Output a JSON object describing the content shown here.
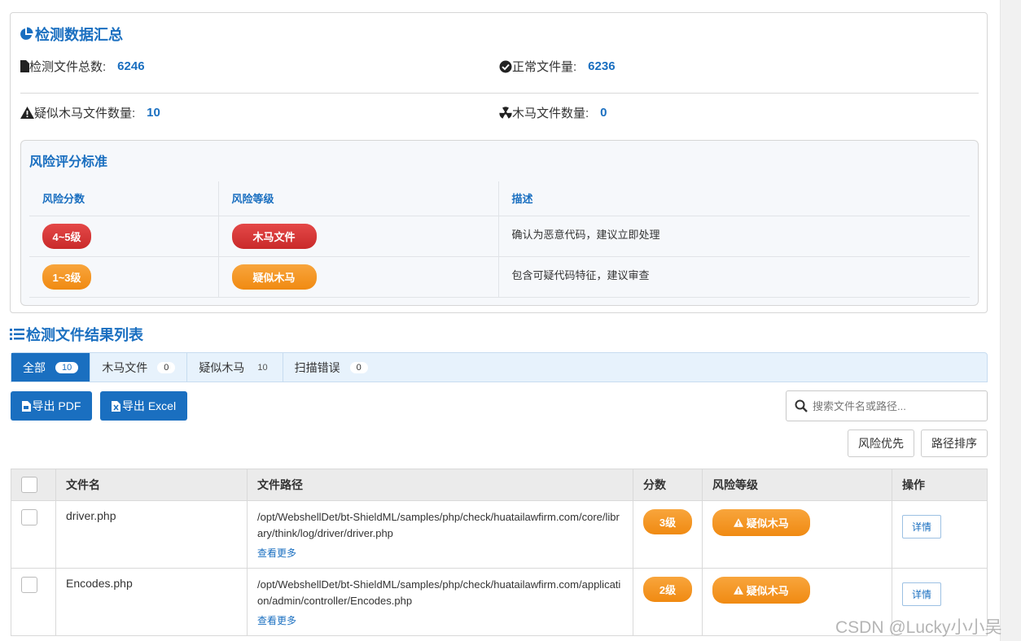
{
  "summary": {
    "title": "检测数据汇总",
    "total_label": "检测文件总数:",
    "total_value": "6246",
    "normal_label": "正常文件量:",
    "normal_value": "6236",
    "suspicious_label": "疑似木马文件数量:",
    "suspicious_value": "10",
    "trojan_label": "木马文件数量:",
    "trojan_value": "0"
  },
  "risk_standard": {
    "title": "风险评分标准",
    "headers": [
      "风险分数",
      "风险等级",
      "描述"
    ],
    "rows": [
      {
        "score": "4~5级",
        "level": "木马文件",
        "desc": "确认为恶意代码，建议立即处理"
      },
      {
        "score": "1~3级",
        "level": "疑似木马",
        "desc": "包含可疑代码特征，建议审查"
      }
    ]
  },
  "results": {
    "title": "检测文件结果列表",
    "tabs": [
      {
        "label": "全部",
        "count": "10"
      },
      {
        "label": "木马文件",
        "count": "0"
      },
      {
        "label": "疑似木马",
        "count": "10"
      },
      {
        "label": "扫描错误",
        "count": "0"
      }
    ],
    "export_pdf": "导出 PDF",
    "export_excel": "导出 Excel",
    "search_placeholder": "搜索文件名或路径...",
    "sort_risk": "风险优先",
    "sort_path": "路径排序",
    "columns": [
      "文件名",
      "文件路径",
      "分数",
      "风险等级",
      "操作"
    ],
    "rows": [
      {
        "name": "driver.php",
        "path": "/opt/WebshellDet/bt-ShieldML/samples/php/check/huatailawfirm.com/core/library/think/log/driver/driver.php",
        "more": "查看更多",
        "score": "3级",
        "level": "疑似木马",
        "action": "详情"
      },
      {
        "name": "Encodes.php",
        "path": "/opt/WebshellDet/bt-ShieldML/samples/php/check/huatailawfirm.com/application/admin/controller/Encodes.php",
        "more": "查看更多",
        "score": "2级",
        "level": "疑似木马",
        "action": "详情"
      }
    ]
  },
  "watermark": "CSDN @Lucky小小吴",
  "colors": {
    "accent": "#1a6fc0",
    "danger": "#d63333",
    "warning": "#f39320"
  }
}
